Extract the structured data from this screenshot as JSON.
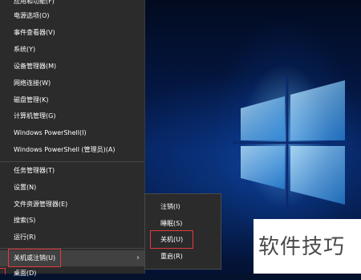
{
  "menu": {
    "items": [
      "应用和功能(F)",
      "电源选项(O)",
      "事件查看器(V)",
      "系统(Y)",
      "设备管理器(M)",
      "网络连接(W)",
      "磁盘管理(K)",
      "计算机管理(G)",
      "Windows PowerShell(I)",
      "Windows PowerShell (管理员)(A)",
      "任务管理器(T)",
      "设置(N)",
      "文件资源管理器(E)",
      "搜索(S)",
      "运行(R)",
      "关机或注销(U)",
      "桌面(D)"
    ],
    "submenu_chevron": "›"
  },
  "submenu": {
    "items": [
      "注销(I)",
      "睡眠(S)",
      "关机(U)",
      "重启(R)"
    ]
  },
  "watermark": {
    "text": "软件技巧"
  },
  "colors": {
    "menu_bg": "#2b2b2b",
    "highlight_bg": "#414141",
    "annotation_red": "#e23b3b",
    "desktop_blue": "#05205a"
  }
}
